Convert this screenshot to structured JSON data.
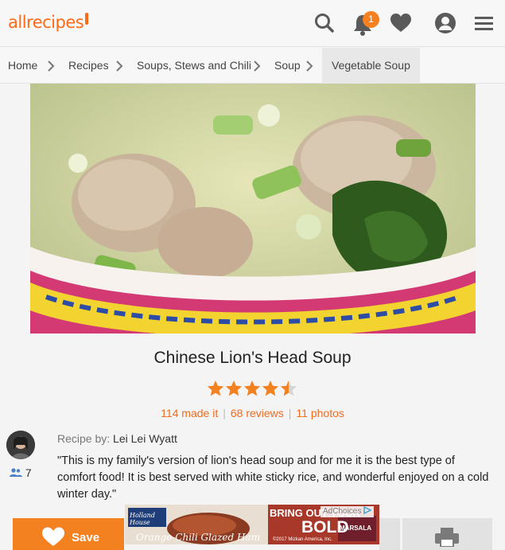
{
  "header": {
    "logo_text": "allrecipes",
    "notification_count": "1",
    "brand_color": "#ff6a13"
  },
  "breadcrumb": [
    "Home",
    "Recipes",
    "Soups, Stews and Chili",
    "Soup",
    "Vegetable Soup"
  ],
  "recipe": {
    "title": "Chinese Lion's Head Soup",
    "rating": 4.5,
    "made_it": "114 made it",
    "reviews": "68 reviews",
    "photos": "11 photos",
    "byline_label": "Recipe by:",
    "author": "Lei Lei Wyatt",
    "author_made_count": "7",
    "description": "\"This is my family's version of lion's head soup and for me it is the best type of comfort food! It is best served with white sticky rice, and wonderful enjoyed on a cold winter day.\""
  },
  "actions": {
    "save_label": "Save"
  },
  "ad": {
    "brand": "Holland House",
    "product": "Orange-Chili Glazed Ham",
    "headline_1": "BRING OUT YOUR",
    "headline_2": "BOLD",
    "variety": "MARSALA",
    "adchoices": "AdChoices",
    "copyright": "©2017 Mizkan America, Inc."
  }
}
